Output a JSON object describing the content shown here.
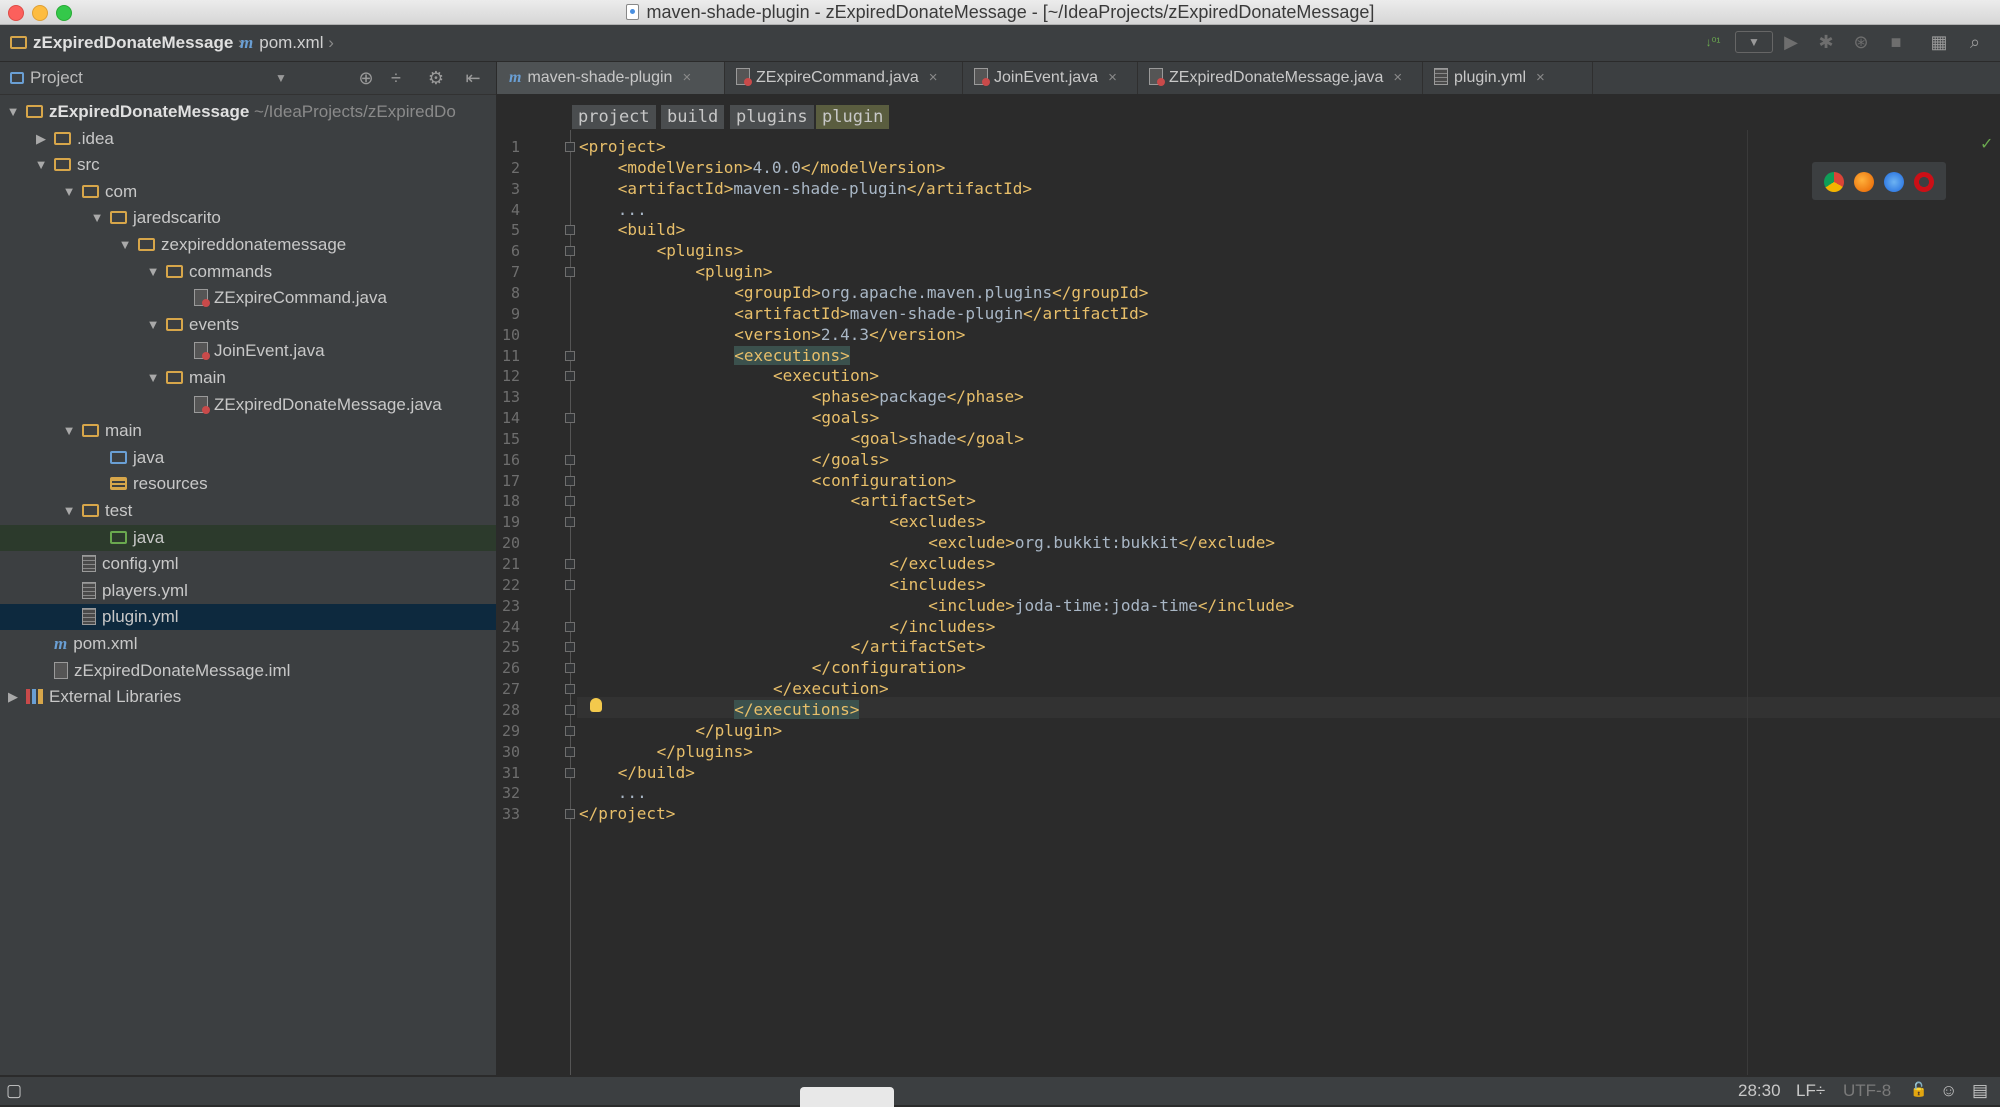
{
  "window": {
    "title": "maven-shade-plugin - zExpiredDonateMessage - [~/IdeaProjects/zExpiredDonateMessage]"
  },
  "navbar": {
    "project": "zExpiredDonateMessage",
    "file": "pom.xml"
  },
  "project_panel": {
    "title": "Project",
    "tree": [
      {
        "label": "zExpiredDonateMessage",
        "suffix": "~/IdeaProjects/zExpiredDo",
        "icon": "folder-icon",
        "level": 0,
        "arrow": "▼"
      },
      {
        "label": ".idea",
        "icon": "folder-icon",
        "level": 1,
        "arrow": "▶"
      },
      {
        "label": "src",
        "icon": "folder-icon",
        "level": 1,
        "arrow": "▼"
      },
      {
        "label": "com",
        "icon": "folder-icon",
        "level": 2,
        "arrow": "▼"
      },
      {
        "label": "jaredscarito",
        "icon": "folder-icon",
        "level": 3,
        "arrow": "▼"
      },
      {
        "label": "zexpireddonatemessage",
        "icon": "folder-icon",
        "level": 4,
        "arrow": "▼"
      },
      {
        "label": "commands",
        "icon": "folder-icon",
        "level": 5,
        "arrow": "▼"
      },
      {
        "label": "ZExpireCommand.java",
        "icon": "java-file-icon",
        "level": 6,
        "arrow": ""
      },
      {
        "label": "events",
        "icon": "folder-icon",
        "level": 5,
        "arrow": "▼"
      },
      {
        "label": "JoinEvent.java",
        "icon": "java-file-icon",
        "level": 6,
        "arrow": ""
      },
      {
        "label": "main",
        "icon": "folder-icon",
        "level": 5,
        "arrow": "▼"
      },
      {
        "label": "ZExpiredDonateMessage.java",
        "icon": "java-file-icon",
        "level": 6,
        "arrow": ""
      },
      {
        "label": "main",
        "icon": "folder-icon",
        "level": 2,
        "arrow": "▼"
      },
      {
        "label": "java",
        "icon": "source-folder-icon",
        "level": 3,
        "arrow": ""
      },
      {
        "label": "resources",
        "icon": "resources-folder-icon",
        "level": 3,
        "arrow": ""
      },
      {
        "label": "test",
        "icon": "folder-icon",
        "level": 2,
        "arrow": "▼"
      },
      {
        "label": "java",
        "icon": "test-folder-icon",
        "level": 3,
        "arrow": ""
      },
      {
        "label": "config.yml",
        "icon": "yml-file-icon",
        "level": 2,
        "arrow": ""
      },
      {
        "label": "players.yml",
        "icon": "yml-file-icon",
        "level": 2,
        "arrow": ""
      },
      {
        "label": "plugin.yml",
        "icon": "yml-file-icon",
        "level": 2,
        "arrow": ""
      },
      {
        "label": "pom.xml",
        "icon": "maven-icon",
        "level": 1,
        "arrow": ""
      },
      {
        "label": "zExpiredDonateMessage.iml",
        "icon": "iml-file-icon",
        "level": 1,
        "arrow": ""
      },
      {
        "label": "External Libraries",
        "icon": "library-icon",
        "level": 0,
        "arrow": "▶"
      }
    ]
  },
  "tabs": [
    {
      "label": "maven-shade-plugin",
      "close": "×"
    },
    {
      "label": "ZExpireCommand.java",
      "close": "×"
    },
    {
      "label": "JoinEvent.java",
      "close": "×"
    },
    {
      "label": "ZExpiredDonateMessage.java",
      "close": "×"
    },
    {
      "label": "plugin.yml",
      "close": "×"
    }
  ],
  "xml_breadcrumbs": [
    "project",
    "build",
    "plugins",
    "plugin"
  ],
  "editor": {
    "lines": [
      {
        "n": "1",
        "indent": 0,
        "parts": [
          [
            "tag",
            "<project>"
          ]
        ]
      },
      {
        "n": "2",
        "indent": 1,
        "parts": [
          [
            "tag",
            "<modelVersion>"
          ],
          [
            "txt",
            "4.0.0"
          ],
          [
            "tag",
            "</modelVersion>"
          ]
        ]
      },
      {
        "n": "3",
        "indent": 1,
        "parts": [
          [
            "tag",
            "<artifactId>"
          ],
          [
            "txt",
            "maven-shade-plugin"
          ],
          [
            "tag",
            "</artifactId>"
          ]
        ]
      },
      {
        "n": "4",
        "indent": 1,
        "parts": [
          [
            "txt",
            "..."
          ]
        ]
      },
      {
        "n": "5",
        "indent": 1,
        "parts": [
          [
            "tag",
            "<build>"
          ]
        ]
      },
      {
        "n": "6",
        "indent": 2,
        "parts": [
          [
            "tag",
            "<plugins>"
          ]
        ]
      },
      {
        "n": "7",
        "indent": 3,
        "parts": [
          [
            "tag",
            "<plugin>"
          ]
        ]
      },
      {
        "n": "8",
        "indent": 4,
        "parts": [
          [
            "tag",
            "<groupId>"
          ],
          [
            "txt",
            "org.apache.maven.plugins"
          ],
          [
            "tag",
            "</groupId>"
          ]
        ]
      },
      {
        "n": "9",
        "indent": 4,
        "parts": [
          [
            "tag",
            "<artifactId>"
          ],
          [
            "txt",
            "maven-shade-plugin"
          ],
          [
            "tag",
            "</artifactId>"
          ]
        ]
      },
      {
        "n": "10",
        "indent": 4,
        "parts": [
          [
            "tag",
            "<version>"
          ],
          [
            "txt",
            "2.4.3"
          ],
          [
            "tag",
            "</version>"
          ]
        ]
      },
      {
        "n": "11",
        "indent": 4,
        "parts": [
          [
            "tagm",
            "<executions>"
          ]
        ]
      },
      {
        "n": "12",
        "indent": 5,
        "parts": [
          [
            "tag",
            "<execution>"
          ]
        ]
      },
      {
        "n": "13",
        "indent": 6,
        "parts": [
          [
            "tag",
            "<phase>"
          ],
          [
            "txt",
            "package"
          ],
          [
            "tag",
            "</phase>"
          ]
        ]
      },
      {
        "n": "14",
        "indent": 6,
        "parts": [
          [
            "tag",
            "<goals>"
          ]
        ]
      },
      {
        "n": "15",
        "indent": 7,
        "parts": [
          [
            "tag",
            "<goal>"
          ],
          [
            "txt",
            "shade"
          ],
          [
            "tag",
            "</goal>"
          ]
        ]
      },
      {
        "n": "16",
        "indent": 6,
        "parts": [
          [
            "tag",
            "</goals>"
          ]
        ]
      },
      {
        "n": "17",
        "indent": 6,
        "parts": [
          [
            "tag",
            "<configuration>"
          ]
        ]
      },
      {
        "n": "18",
        "indent": 7,
        "parts": [
          [
            "tag",
            "<artifactSet>"
          ]
        ]
      },
      {
        "n": "19",
        "indent": 8,
        "parts": [
          [
            "tag",
            "<excludes>"
          ]
        ]
      },
      {
        "n": "20",
        "indent": 9,
        "parts": [
          [
            "tag",
            "<exclude>"
          ],
          [
            "txt",
            "org.bukkit:bukkit"
          ],
          [
            "tag",
            "</exclude>"
          ]
        ]
      },
      {
        "n": "21",
        "indent": 8,
        "parts": [
          [
            "tag",
            "</excludes>"
          ]
        ]
      },
      {
        "n": "22",
        "indent": 8,
        "parts": [
          [
            "tag",
            "<includes>"
          ]
        ]
      },
      {
        "n": "23",
        "indent": 9,
        "parts": [
          [
            "tag",
            "<include>"
          ],
          [
            "txt",
            "joda-time:joda-time"
          ],
          [
            "tag",
            "</include>"
          ]
        ]
      },
      {
        "n": "24",
        "indent": 8,
        "parts": [
          [
            "tag",
            "</includes>"
          ]
        ]
      },
      {
        "n": "25",
        "indent": 7,
        "parts": [
          [
            "tag",
            "</artifactSet>"
          ]
        ]
      },
      {
        "n": "26",
        "indent": 6,
        "parts": [
          [
            "tag",
            "</configuration>"
          ]
        ]
      },
      {
        "n": "27",
        "indent": 5,
        "parts": [
          [
            "tag",
            "</execution>"
          ]
        ]
      },
      {
        "n": "28",
        "indent": 4,
        "parts": [
          [
            "tagm",
            "</executions>"
          ]
        ]
      },
      {
        "n": "29",
        "indent": 3,
        "parts": [
          [
            "tag",
            "</plugin>"
          ]
        ]
      },
      {
        "n": "30",
        "indent": 2,
        "parts": [
          [
            "tag",
            "</plugins>"
          ]
        ]
      },
      {
        "n": "31",
        "indent": 1,
        "parts": [
          [
            "tag",
            "</build>"
          ]
        ]
      },
      {
        "n": "32",
        "indent": 1,
        "parts": [
          [
            "txt",
            "..."
          ]
        ]
      },
      {
        "n": "33",
        "indent": 0,
        "parts": [
          [
            "tag",
            "</project>"
          ]
        ]
      }
    ],
    "fold_lines": [
      "1",
      "5",
      "6",
      "7",
      "11",
      "12",
      "14",
      "16",
      "17",
      "18",
      "19",
      "21",
      "22",
      "24",
      "25",
      "26",
      "27",
      "28",
      "29",
      "30",
      "31",
      "33"
    ]
  },
  "status": {
    "position": "28:30",
    "line_sep": "LF÷",
    "encoding": "UTF-8"
  },
  "colors": {
    "tag": "#e8bf6a",
    "text": "#a9b7c6",
    "selection": "#0d293e"
  }
}
